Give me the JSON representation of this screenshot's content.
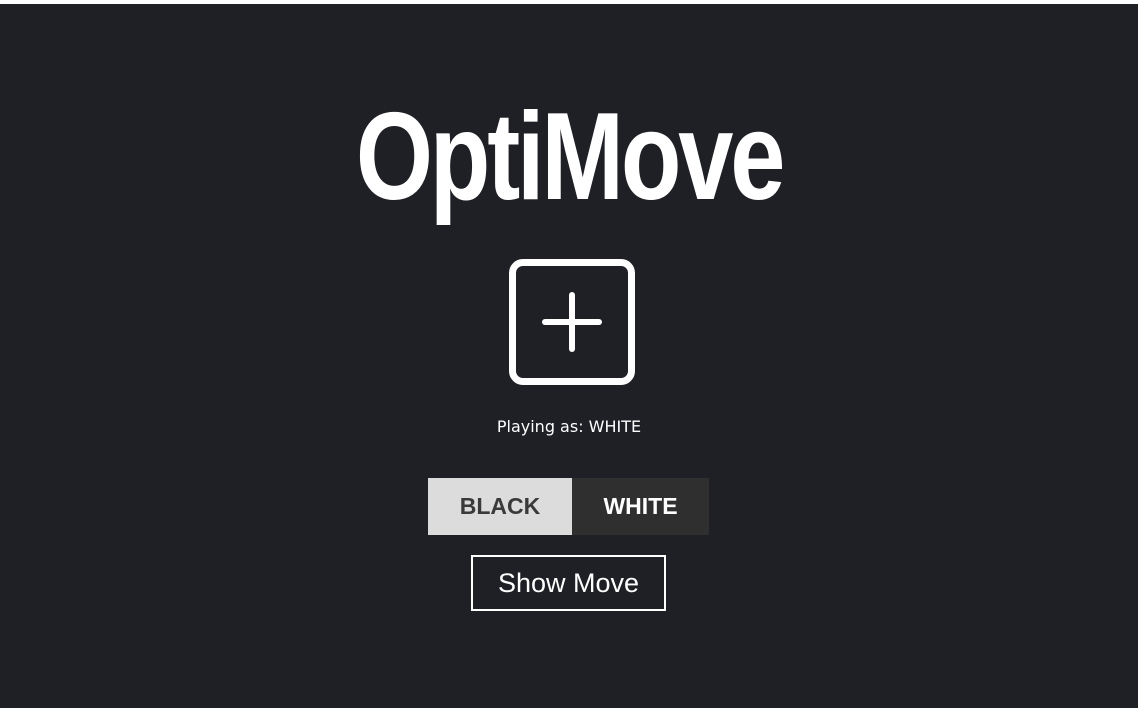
{
  "app": {
    "title": "OptiMove"
  },
  "upload": {
    "icon": "plus-icon"
  },
  "status": {
    "text": "Playing as: WHITE"
  },
  "color_toggle": {
    "options": [
      {
        "label": "BLACK"
      },
      {
        "label": "WHITE"
      }
    ],
    "selected": "WHITE"
  },
  "actions": {
    "show_move_label": "Show Move"
  },
  "colors": {
    "background": "#1f2025",
    "foreground": "#ffffff",
    "toggle_light": "#dcdcdc",
    "toggle_dark": "#2f2f2f"
  }
}
